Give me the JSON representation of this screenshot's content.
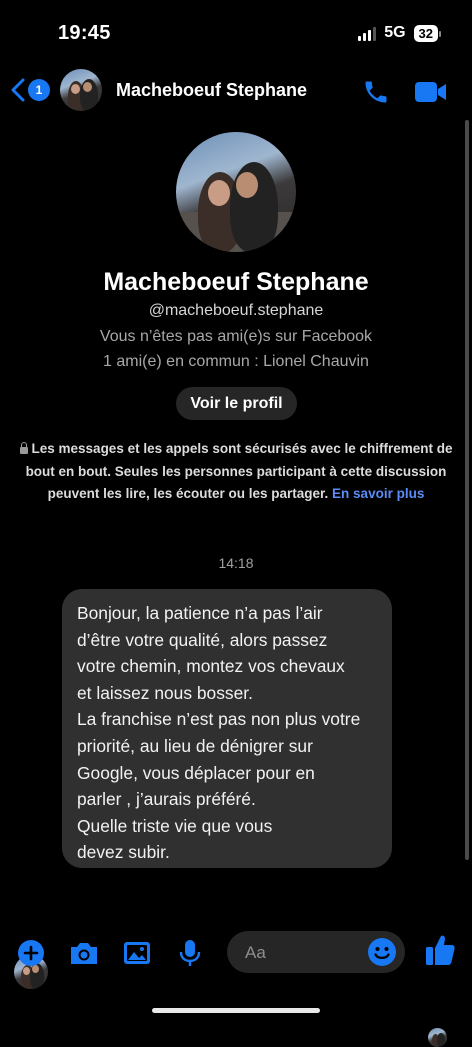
{
  "status_bar": {
    "time": "19:45",
    "network": "5G",
    "battery": "32"
  },
  "header": {
    "back_badge": "1",
    "contact_name": "Macheboeuf Stephane",
    "back_icon": "chevron-left-icon",
    "call_icon": "phone-icon",
    "video_icon": "video-camera-icon"
  },
  "profile": {
    "name": "Macheboeuf Stephane",
    "handle": "@macheboeuf.stephane",
    "friend_status": "Vous n’êtes pas ami(e)s sur Facebook",
    "mutual_friends": "1 ami(e) en commun : Lionel Chauvin",
    "view_profile_label": "Voir le profil"
  },
  "security_notice": {
    "text": "Les messages et les appels sont sécurisés avec le chiffrement de bout en bout. Seules les personnes participant à cette discussion peuvent les lire, les écouter ou les partager.",
    "link": "En savoir plus"
  },
  "conversation": {
    "timestamp": "14:18",
    "message_lines": [
      "Bonjour, la patience n’a pas l’air",
      "d’être votre qualité, alors passez",
      "votre chemin, montez vos chevaux",
      "et laissez nous bosser.",
      "La franchise n’est pas non plus votre",
      "priorité, au lieu de dénigrer sur",
      "Google, vous déplacer pour en",
      "parler , j’aurais préféré.",
      "Quelle triste vie que vous",
      "devez subir."
    ]
  },
  "composer": {
    "placeholder": "Aa",
    "icons": [
      "plus-icon",
      "camera-icon",
      "image-icon",
      "microphone-icon",
      "emoji-icon",
      "like-icon"
    ]
  },
  "colors": {
    "accent": "#1877f2",
    "link": "#5b8cf5",
    "bubble": "#303030",
    "background": "#000000"
  }
}
